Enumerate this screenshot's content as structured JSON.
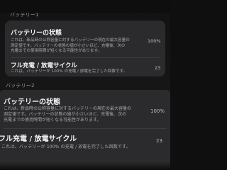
{
  "sections": [
    {
      "label": "バッテリー1",
      "rows": [
        {
          "title": "バッテリーの状態",
          "desc_lines": [
            "これは、新品時の公称容量に対するバッテリーの現在の最大容量の",
            "測定値です。バッテリーの状態の値が小さいほど、充電後、次の",
            "充電までの使用時間が短くなる可能性があります。"
          ],
          "value": "100%"
        },
        {
          "title": "フル充電 / 放電サイクル",
          "desc_lines": [
            "これは、バッテリーが 100% の充電 / 放電を完了した回数です。"
          ],
          "value": "23"
        }
      ]
    },
    {
      "label": "バッテリー2",
      "rows": [
        {
          "title": "バッテリーの状態",
          "desc_lines": [
            "これは、新品時の公称容量に対するバッテリーの現在の最大容量の",
            "測定値です。バッテリーの状態の値が小さいほど、充電後、次の",
            "充電までの使用時間が短くなる可能性があります。"
          ],
          "value": "100%"
        },
        {
          "title": "フル充電 / 放電サイクル",
          "desc_lines": [
            "これは、バッテリーが 100% の充電 / 放電を完了した回数です。"
          ],
          "value": "23"
        }
      ]
    }
  ]
}
